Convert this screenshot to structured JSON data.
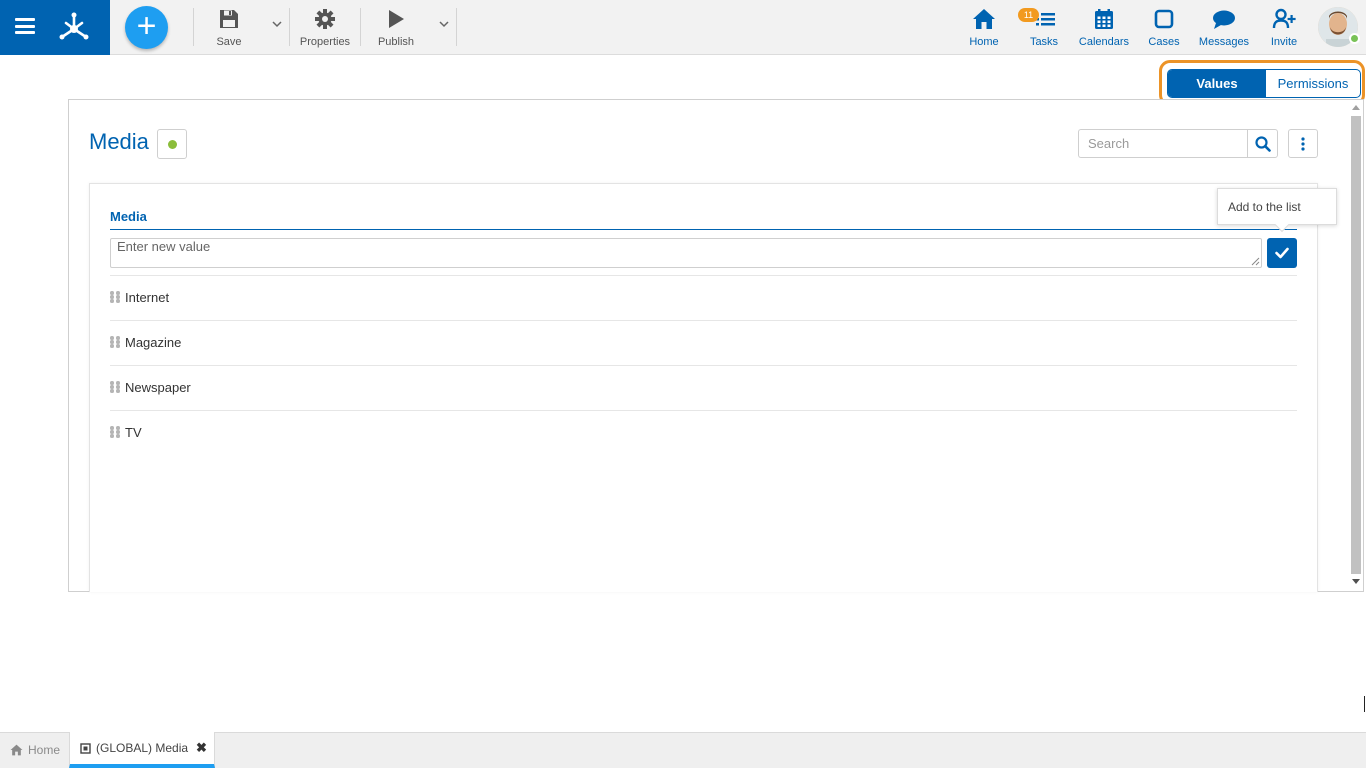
{
  "toolbar": {
    "save_label": "Save",
    "properties_label": "Properties",
    "publish_label": "Publish"
  },
  "nav": {
    "home_label": "Home",
    "tasks_label": "Tasks",
    "tasks_count": "11",
    "calendars_label": "Calendars",
    "cases_label": "Cases",
    "messages_label": "Messages",
    "invite_label": "Invite"
  },
  "tabs": {
    "values_label": "Values",
    "permissions_label": "Permissions",
    "active": "Values"
  },
  "page": {
    "title": "Media",
    "status_color": "#8bbd3a",
    "search_placeholder": "Search"
  },
  "field": {
    "label": "Media",
    "new_value_placeholder": "Enter new value",
    "add_tooltip": "Add to the list"
  },
  "values": [
    "Internet",
    "Magazine",
    "Newspaper",
    "TV"
  ],
  "bottom_tabs": {
    "home_label": "Home",
    "doc_label": "(GLOBAL) Media"
  },
  "colors": {
    "brand": "#0063b1",
    "accent": "#1e9ef1",
    "highlight": "#ec9327",
    "badge": "#f29a1f"
  },
  "icons": {
    "menu": "hamburger-icon",
    "logo": "app-logo-icon",
    "add": "plus-icon",
    "save": "floppy-disk-icon",
    "properties": "gear-icon",
    "publish": "play-icon",
    "home": "house-icon",
    "tasks": "task-list-icon",
    "calendars": "calendar-icon",
    "cases": "square-icon",
    "messages": "chat-bubble-icon",
    "invite": "add-user-icon",
    "search": "search-icon",
    "more": "kebab-icon",
    "confirm": "checkmark-icon",
    "drag": "drag-handle-icon",
    "close": "close-icon"
  }
}
